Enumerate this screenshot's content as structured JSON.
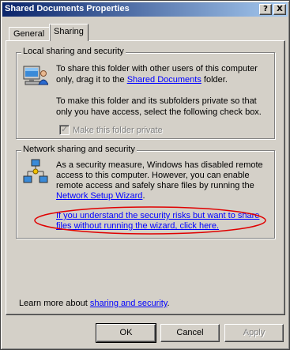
{
  "window": {
    "title": "Shared Documents Properties",
    "help_label": "?",
    "close_label": "X"
  },
  "tabs": [
    {
      "label": "General",
      "active": false
    },
    {
      "label": "Sharing",
      "active": true
    }
  ],
  "local": {
    "title": "Local sharing and security",
    "para1_line1": "To share this folder with other users of this computer",
    "para1_line2_pre": "only, drag it to the ",
    "para1_link": "Shared Documents",
    "para1_line2_post": " folder.",
    "para2_line1": "To make this folder and its subfolders private so that",
    "para2_line2": "only you have access, select the following check box.",
    "checkbox_label": "Make this folder private",
    "checkbox_checked": true,
    "checkbox_disabled": true
  },
  "network": {
    "title": "Network sharing and security",
    "para_line1": "As a security measure, Windows has disabled remote",
    "para_line2": "access to this computer. However, you can enable",
    "para_line3": "remote access and safely share files by running the",
    "wizard_link": "Network Setup Wizard",
    "wizard_link_suffix": ".",
    "risk_link_line1": "If you understand the security risks but want to share",
    "risk_link_line2": "files without running the wizard, click here."
  },
  "learn_more": {
    "prefix": "Learn more about ",
    "link": "sharing and security",
    "suffix": "."
  },
  "buttons": {
    "ok": "OK",
    "cancel": "Cancel",
    "apply": "Apply"
  },
  "colors": {
    "title_start": "#0a246a",
    "title_end": "#a6caf0",
    "link": "#0000ff",
    "highlight_ellipse": "#e00000"
  }
}
